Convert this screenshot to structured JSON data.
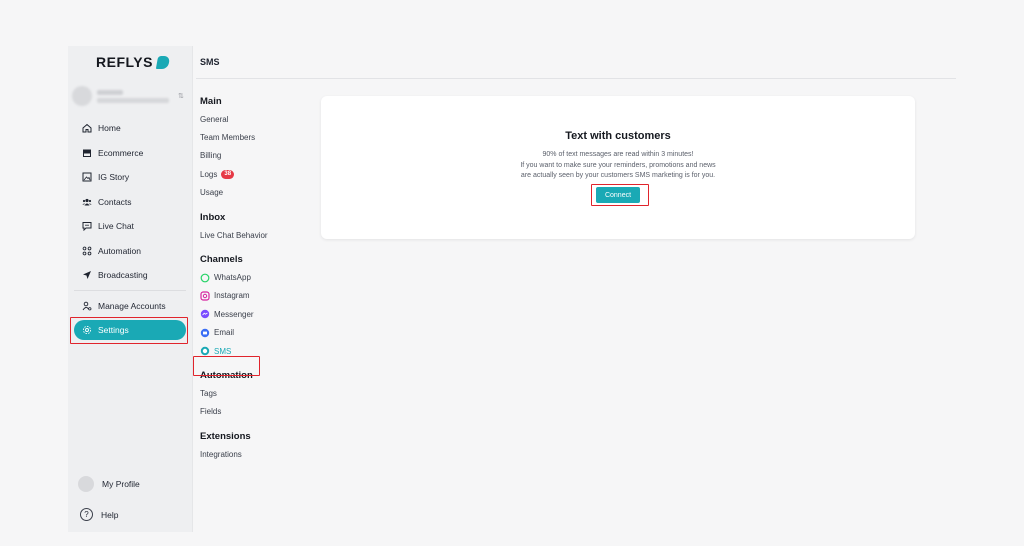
{
  "brand": {
    "name": "REFLYS"
  },
  "sidebar": {
    "items": [
      {
        "label": "Home",
        "icon": "home-icon"
      },
      {
        "label": "Ecommerce",
        "icon": "store-icon"
      },
      {
        "label": "IG Story",
        "icon": "image-icon"
      },
      {
        "label": "Contacts",
        "icon": "users-icon"
      },
      {
        "label": "Live Chat",
        "icon": "chat-icon"
      },
      {
        "label": "Automation",
        "icon": "automation-icon"
      },
      {
        "label": "Broadcasting",
        "icon": "send-icon"
      }
    ],
    "manage_accounts": "Manage Accounts",
    "settings": "Settings",
    "my_profile": "My Profile",
    "help": "Help"
  },
  "page": {
    "title": "SMS"
  },
  "submenu": {
    "main_title": "Main",
    "main": [
      "General",
      "Team Members",
      "Billing",
      "Logs",
      "Usage"
    ],
    "logs_badge": "38",
    "inbox_title": "Inbox",
    "inbox": [
      "Live Chat Behavior"
    ],
    "channels_title": "Channels",
    "channels": [
      "WhatsApp",
      "Instagram",
      "Messenger",
      "Email",
      "SMS"
    ],
    "automation_title": "Automation",
    "automation": [
      "Tags",
      "Fields"
    ],
    "extensions_title": "Extensions",
    "extensions": [
      "Integrations"
    ]
  },
  "card": {
    "title": "Text with customers",
    "line1": "90% of text messages are read within 3 minutes!",
    "line2": "If you want to make sure your reminders, promotions and news",
    "line3": "are actually seen by your customers SMS marketing is for you.",
    "connect_label": "Connect"
  },
  "colors": {
    "accent": "#1aa9b5",
    "highlight": "#e0242c",
    "badge": "#e63946"
  }
}
